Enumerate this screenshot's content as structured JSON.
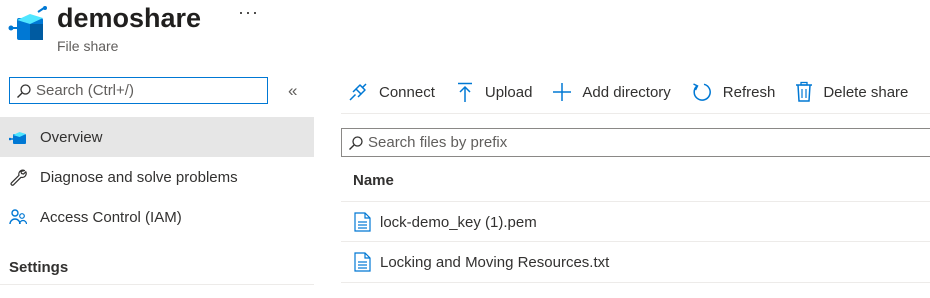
{
  "header": {
    "title": "demoshare",
    "subtitle": "File share",
    "more_label": "···"
  },
  "sidebar": {
    "search_placeholder": "Search (Ctrl+/)",
    "collapse_label": "«",
    "items": [
      {
        "label": "Overview",
        "icon": "file-share-icon",
        "active": true
      },
      {
        "label": "Diagnose and solve problems",
        "icon": "wrench-icon"
      },
      {
        "label": "Access Control (IAM)",
        "icon": "people-icon"
      }
    ],
    "section_title": "Settings"
  },
  "toolbar": {
    "connect": "Connect",
    "upload": "Upload",
    "add_directory": "Add directory",
    "refresh": "Refresh",
    "delete_share": "Delete share"
  },
  "files": {
    "search_placeholder": "Search files by prefix",
    "column_name": "Name",
    "rows": [
      {
        "name": "lock-demo_key (1).pem"
      },
      {
        "name": "Locking and Moving Resources.txt"
      }
    ]
  },
  "colors": {
    "accent": "#0078d4",
    "active_bg": "#e6e6e6",
    "text": "#323130"
  }
}
